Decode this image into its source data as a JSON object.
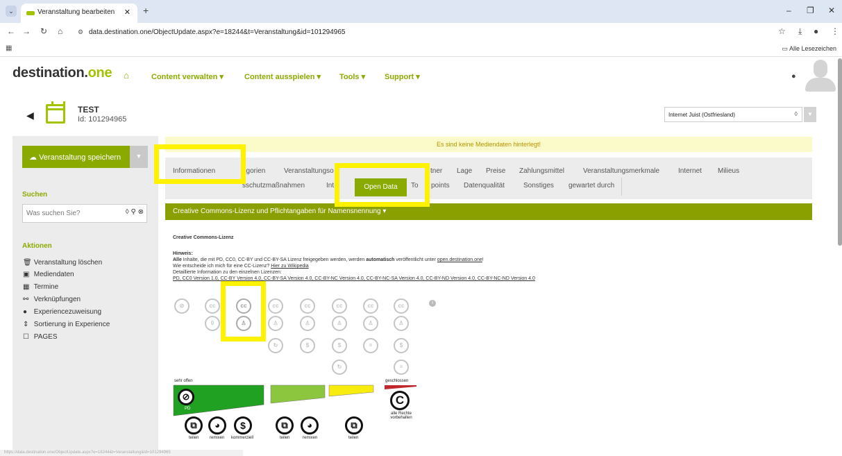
{
  "browser": {
    "tab_title": "Veranstaltung bearbeiten",
    "url": "data.destination.one/ObjectUpdate.aspx?e=18244&t=Veranstaltung&id=101294965",
    "bookmarks_all": "Alle Lesezeichen",
    "status_url": "https://data.destination.one/ObjectUpdate.aspx?e=18244&t=Veranstaltung&id=101294965"
  },
  "header": {
    "logo_main": "destination.",
    "logo_accent": "one",
    "nav": [
      "Content verwalten ▾",
      "Content ausspielen ▾",
      "Tools ▾",
      "Support ▾"
    ]
  },
  "object": {
    "title": "TEST",
    "id_text": "Id: 101294965",
    "region": "Internet Juist (Ostfriesland)"
  },
  "sidebar": {
    "save_label": "Veranstaltung speichern",
    "search_heading": "Suchen",
    "search_placeholder": "Was suchen Sie?",
    "actions_heading": "Aktionen",
    "actions": [
      {
        "label": "Veranstaltung löschen",
        "icon": "trash-icon"
      },
      {
        "label": "Mediendaten",
        "icon": "image-icon"
      },
      {
        "label": "Termine",
        "icon": "calendar-icon"
      },
      {
        "label": "Verknüpfungen",
        "icon": "link-icon"
      },
      {
        "label": "Experiencezuweisung",
        "icon": "globe-icon"
      },
      {
        "label": "Sortierung in Experience",
        "icon": "sort-icon"
      },
      {
        "label": "PAGES",
        "icon": "page-icon"
      }
    ]
  },
  "main": {
    "notice": "Es sind keine Mediendaten hinterlegt!",
    "tabs_row1": [
      "Informationen",
      "egorien",
      "Veranstaltungso",
      "tner",
      "Lage",
      "Preise",
      "Zahlungsmittel",
      "Veranstaltungsmerkmale",
      "Internet",
      "Milieus"
    ],
    "tabs_row2": [
      "sschutzmaßnahmen",
      "Int",
      "Open Data",
      "To",
      "points",
      "Datenqualität",
      "Sonstiges",
      "gewartet durch"
    ],
    "section_title": "Creative Commons-Lizenz und Pflichtangaben für Namensnennung ▾",
    "cc_heading": "Creative Commons-Lizenz",
    "hint_label": "Hinweis:",
    "hint_line1_bold": "Alle",
    "hint_line1_mid": " Inhalte, die mit PD, CC0, CC-BY und CC-BY-SA Lizenz freigegeben werden, werden ",
    "hint_line1_bold2": "automatisch",
    "hint_line1_end": " veröffentlicht unter ",
    "hint_line1_link": "open.destination.one",
    "hint_line2": "Wie entscheide ich mich für eine CC-Lizenz? ",
    "hint_line2_link": "Hier zu Wikipedia",
    "hint_line3": "Detaillierte Information zu den einzelnen Lizenzen:",
    "license_links": "PD, CC0 Version 1.0, CC-BY Version 4.0, CC-BY-SA Version 4.0, CC-BY-NC Version 4.0, CC-BY-NC-SA Version 4.0, CC-BY-ND Version 4.0, CC-BY-NC-ND Version 4.0",
    "scale_open": "sehr offen",
    "scale_closed": "geschlossen",
    "pd_label": "PD",
    "all_rights": "alle Rechte vorbehalten",
    "share": "teilen",
    "remix": "remixen",
    "commercial": "kommerziell"
  }
}
